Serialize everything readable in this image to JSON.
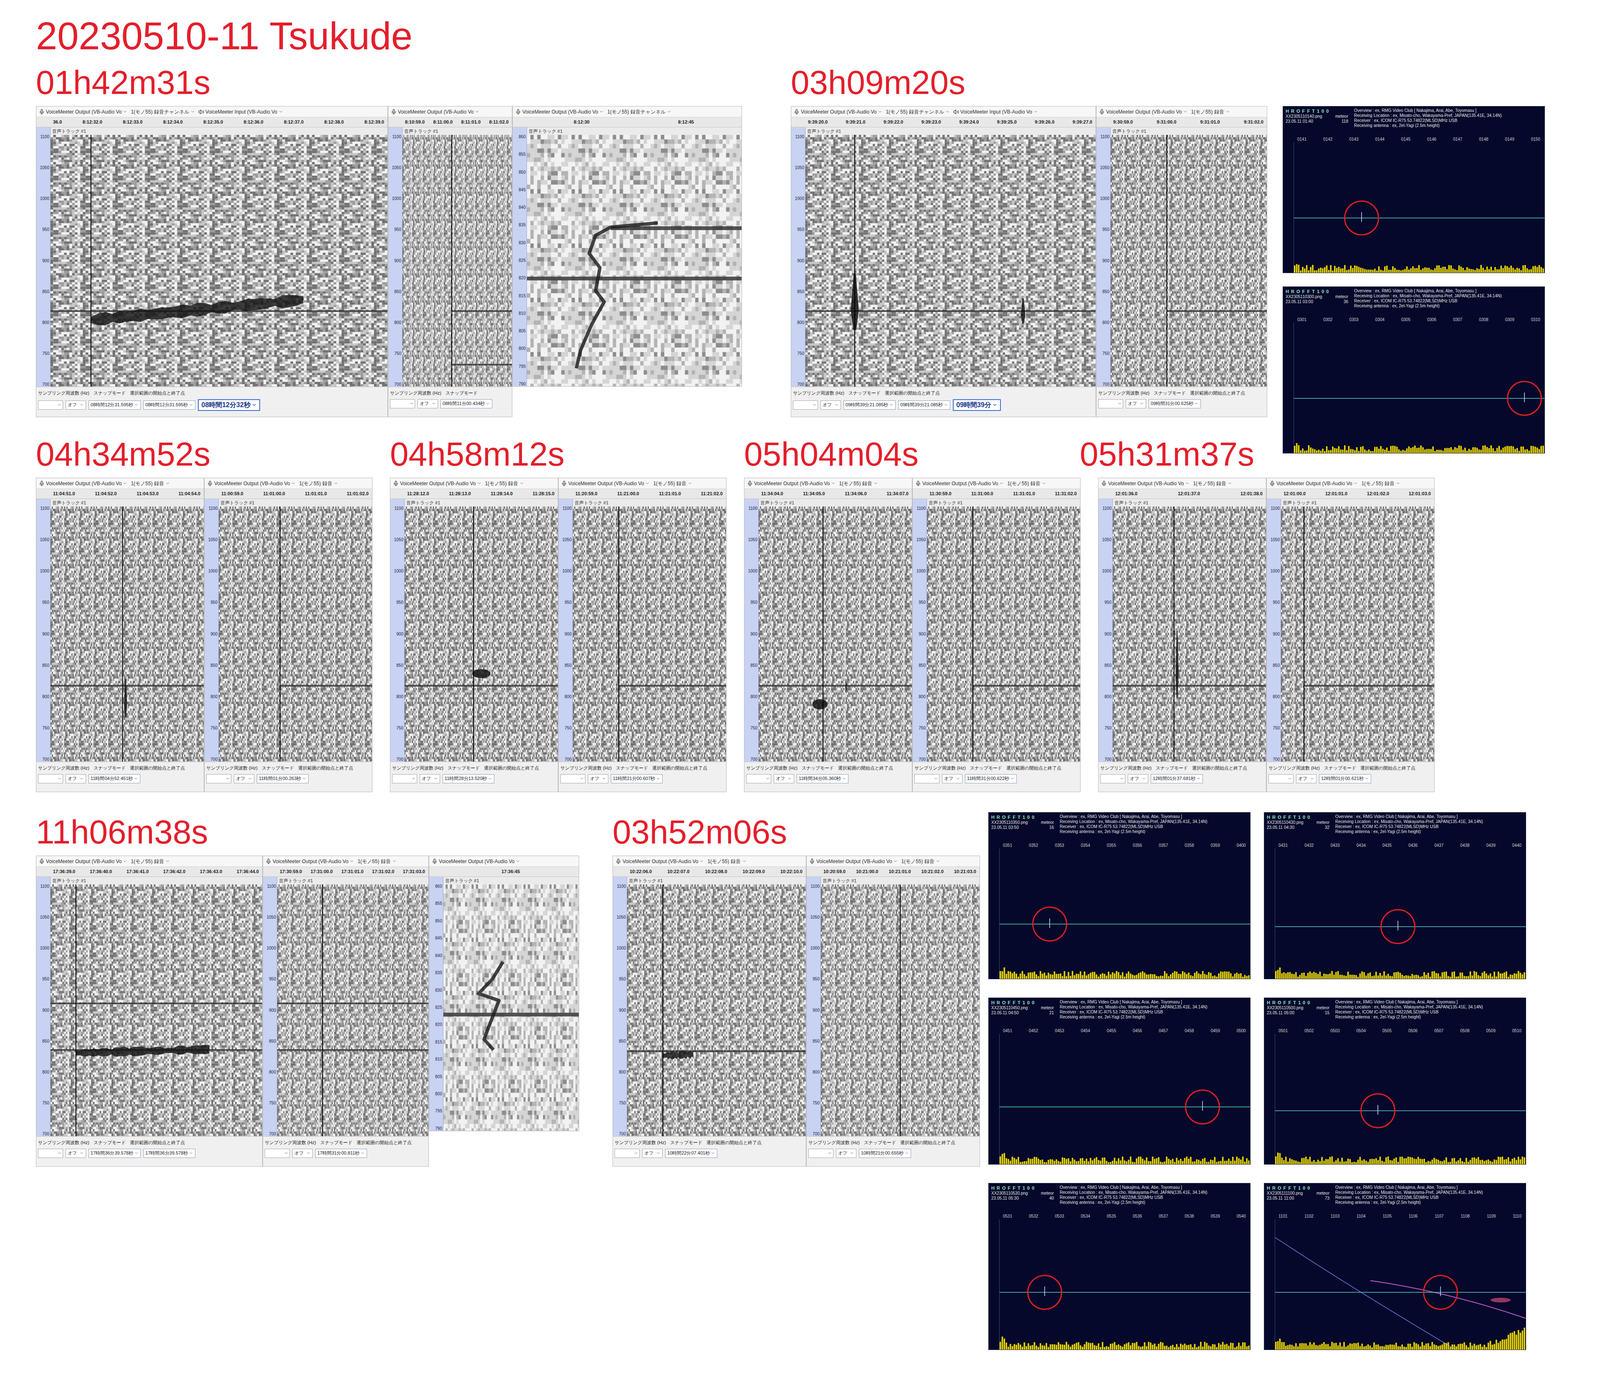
{
  "title": "20230510-11 Tsukude",
  "track_label": "音声トラック #1",
  "freq_ticks": [
    "1100",
    "1050",
    "1000",
    "950",
    "900",
    "850",
    "800",
    "750",
    "700"
  ],
  "zoom_ticks": [
    "860",
    "855",
    "850",
    "845",
    "840",
    "835",
    "830",
    "825",
    "820",
    "815",
    "810",
    "805",
    "800",
    "795",
    "790"
  ],
  "hroft_header": {
    "title": "H R O F F T 1 0 0",
    "info": [
      "Overview : ex, RMG Video Club [ Nakajima, Arai, Abe, Toyomasu ]",
      "Receiving Location : ex, Misato-cho, Wakayama-Pref, JAPAN(135.41E, 34.14N)",
      "Receiver : ex, ICOM IC-R75 53.74822(MLSD)MHz USB",
      "Receiving antenna : ex, 2el-Yagi (2.5m height)"
    ]
  },
  "groups": [
    {
      "time": "01h42m31s",
      "panels": [
        {
          "kind": "spectrogram",
          "toolbar": [
            "VoiceMeeter Output (VB-Audio Vo",
            "1(モノ55) 録音チャンネル",
            "VoiceMeeter Input (VB-Audio Vo"
          ],
          "ruler": [
            "36.0",
            "8:12:32.0",
            "8:12:33.0",
            "8:12:34.0",
            "8:12:35.0",
            "8:12:36.0",
            "8:12:37.0",
            "8:12:38.0",
            "8:12:39.0"
          ],
          "cursor": 0.12,
          "carriers": [
            {
              "hz": 820,
              "t0": 0
            }
          ],
          "echoes": [
            {
              "kind": "streak",
              "t0": 0.12,
              "t1": 0.75,
              "hz0": 806,
              "hz1": 838,
              "width": 22
            }
          ],
          "footer_labels": [
            "サンプリング周波数 (Hz)",
            "スナップモード",
            "選択範囲の開始点と終了点"
          ],
          "snap": "オフ",
          "selection": [
            "08時間12分31.595秒",
            "08時間12分31.595秒"
          ],
          "position": "08時間12分32秒"
        },
        {
          "kind": "spectrogram",
          "toolbar": [
            "VoiceMeeter Output (VB-Audio Vo"
          ],
          "ruler": [
            "8:10:59.0",
            "8:11:00.0",
            "8:11:01.0",
            "8:11:02.0"
          ],
          "cursor": 0.45,
          "carriers": [
            {
              "hz": 820,
              "t0": 0.45
            },
            {
              "hz": 735,
              "t0": 0.45
            }
          ],
          "echoes": [],
          "footer_labels": [
            "サンプリング周波数 (Hz)",
            "スナップモード"
          ],
          "snap": "オフ",
          "selection": [
            "08時間11分00.434秒"
          ]
        },
        {
          "kind": "zoom",
          "toolbar": [
            "VoiceMeeter Output (VB-Audio Vo",
            "1(モノ55) 録音チャンネル"
          ],
          "ruler": [
            "8:12:30",
            "8:12:45"
          ],
          "carriers": [
            {
              "hz": 820,
              "t0": 0
            },
            {
              "hz": 834,
              "t0": 0.39
            }
          ],
          "path": [
            [
              0.61,
              835.5
            ],
            [
              0.39,
              834.3
            ],
            [
              0.32,
              832
            ],
            [
              0.29,
              827
            ],
            [
              0.34,
              823
            ],
            [
              0.32,
              816.6
            ],
            [
              0.36,
              813.5
            ],
            [
              0.3,
              807
            ],
            [
              0.25,
              800
            ],
            [
              0.23,
              795
            ]
          ]
        }
      ]
    },
    {
      "time": "03h09m20s",
      "panels": [
        {
          "kind": "spectrogram",
          "toolbar": [
            "VoiceMeeter Output (VB-Audio Vo",
            "1(モノ55) 録音チャンネル",
            "VoiceMeeter Input (VB-Audio Vo"
          ],
          "ruler": [
            "9:39:20.0",
            "9:39:21.0",
            "9:39:22.0",
            "9:39:23.0",
            "9:39:24.0",
            "9:39:25.0",
            "9:39:26.0",
            "9:39:27.0"
          ],
          "cursor": 0.17,
          "carriers": [
            {
              "hz": 820,
              "t0": 0
            }
          ],
          "echoes": [
            {
              "kind": "spike",
              "t": 0.17,
              "hz0": 790,
              "hz1": 880,
              "width": 14
            },
            {
              "kind": "spike",
              "t": 0.75,
              "hz0": 800,
              "hz1": 840,
              "width": 8
            }
          ],
          "footer_labels": [
            "サンプリング周波数 (Hz)",
            "スナップモード",
            "選択範囲の開始点と終了点"
          ],
          "snap": "オフ",
          "selection": [
            "09時間39分21.085秒",
            "09時間39分21.085秒"
          ],
          "position": "09時間39分"
        },
        {
          "kind": "spectrogram",
          "toolbar": [
            "VoiceMeeter Output (VB-Audio Vo",
            "1(モノ55) 録音"
          ],
          "ruler": [
            "9:30:59.0",
            "9:31:00.0",
            "9:31:01.0",
            "9:31:02.0"
          ],
          "cursor": 0.36,
          "carriers": [
            {
              "hz": 820,
              "t0": 0.36
            }
          ],
          "echoes": [],
          "footer_labels": [
            "サンプリング周波数 (Hz)",
            "スナップモード",
            "選択範囲の開始点と終了点"
          ],
          "snap": "オフ",
          "selection": [
            "09時間31分00.625秒"
          ]
        }
      ],
      "hroft": [
        {
          "file": "XX2305110140.png",
          "label": "meteor",
          "count": "118",
          "date": "23.05.11 01:40",
          "ticks": [
            "0141",
            "0142",
            "0143",
            "0144",
            "0145",
            "0146",
            "0147",
            "0148",
            "0149",
            "0150"
          ],
          "line": 0.58,
          "mark": 0.27,
          "aircraft": false
        },
        {
          "file": "XX2305110300.png",
          "label": "meteor",
          "count": "36",
          "date": "23.05.11 03:00",
          "ticks": [
            "0301",
            "0302",
            "0303",
            "0304",
            "0305",
            "0306",
            "0307",
            "0308",
            "0309",
            "0310"
          ],
          "line": 0.58,
          "mark": 0.92,
          "aircraft": false
        }
      ]
    },
    {
      "time": "04h34m52s",
      "panels": [
        {
          "kind": "spectrogram",
          "toolbar": [
            "VoiceMeeter Output (VB-Audio Vo",
            "1(モノ55) 録音"
          ],
          "ruler": [
            "11:04:51.0",
            "11:04:52.0",
            "11:04:53.0",
            "11:04:54.0"
          ],
          "cursor": 0.47,
          "carriers": [
            {
              "hz": 819,
              "t0": 0
            }
          ],
          "echoes": [
            {
              "kind": "spike",
              "t": 0.49,
              "hz0": 770,
              "hz1": 830,
              "width": 10
            }
          ],
          "footer_labels": [
            "サンプリング周波数 (Hz)",
            "スナップモード",
            "選択範囲の開始点と終了点"
          ],
          "snap": "オフ",
          "selection": [
            "11時間04分52.451秒"
          ]
        },
        {
          "kind": "spectrogram",
          "toolbar": [
            "VoiceMeeter Output (VB-Audio Vo",
            "1(モノ55) 録音"
          ],
          "ruler": [
            "11:00:59.0",
            "11:01:00.0",
            "11:01:01.0",
            "11:01:02.0"
          ],
          "cursor": 0.4,
          "carriers": [
            {
              "hz": 819,
              "t0": 0.4
            }
          ],
          "echoes": [],
          "footer_labels": [
            "サンプリング周波数 (Hz)",
            "スナップモード",
            "選択範囲の開始点と終了点"
          ],
          "snap": "オフ",
          "selection": [
            "11時間01分00.263秒"
          ]
        }
      ]
    },
    {
      "time": "04h58m12s",
      "panels": [
        {
          "kind": "spectrogram",
          "toolbar": [
            "VoiceMeeter Output (VB-Audio Vo",
            "1(モノ55) 録音"
          ],
          "ruler": [
            "11:28:12.0",
            "11:28:13.0",
            "11:28:14.0",
            "11:28:15.0"
          ],
          "cursor": 0.45,
          "carriers": [
            {
              "hz": 819,
              "t0": 0
            }
          ],
          "echoes": [
            {
              "kind": "blob",
              "t": 0.5,
              "hz": 838,
              "dt": 0.12,
              "dhz": 14
            }
          ],
          "footer_labels": [
            "サンプリング周波数 (Hz)",
            "スナップモード",
            "選択範囲の開始点と終了点"
          ],
          "snap": "オフ",
          "selection": [
            "11時間28分13.520秒"
          ]
        },
        {
          "kind": "spectrogram",
          "toolbar": [
            "VoiceMeeter Output (VB-Audio Vo",
            "1(モノ55) 録音"
          ],
          "ruler": [
            "11:20:59.0",
            "11:21:00.0",
            "11:21:01.0",
            "11:21:02.0"
          ],
          "cursor": 0.3,
          "carriers": [
            {
              "hz": 819,
              "t0": 0.3
            }
          ],
          "echoes": [],
          "footer_labels": [
            "サンプリング周波数 (Hz)",
            "スナップモード",
            "選択範囲の開始点と終了点"
          ],
          "snap": "オフ",
          "selection": [
            "11時間21分00.607秒"
          ]
        }
      ]
    },
    {
      "time": "05h04m04s",
      "panels": [
        {
          "kind": "spectrogram",
          "toolbar": [
            "VoiceMeeter Output (VB-Audio Vo",
            "1(モノ55) 録音"
          ],
          "ruler": [
            "11:34:04.0",
            "11:34:05.0",
            "11:34:06.0",
            "11:34:07.0"
          ],
          "cursor": 0.42,
          "carriers": [
            {
              "hz": 819,
              "t0": 0
            }
          ],
          "echoes": [
            {
              "kind": "blob",
              "t": 0.4,
              "hz": 790,
              "dt": 0.1,
              "dhz": 16
            },
            {
              "kind": "spike",
              "t": 0.57,
              "hz0": 808,
              "hz1": 830,
              "width": 5
            }
          ],
          "footer_labels": [
            "サンプリング周波数 (Hz)",
            "スナップモード",
            "選択範囲の開始点と終了点"
          ],
          "snap": "オフ",
          "selection": [
            "11時間34分05.360秒"
          ]
        },
        {
          "kind": "spectrogram",
          "toolbar": [
            "VoiceMeeter Output (VB-Audio Vo",
            "1(モノ55) 録音"
          ],
          "ruler": [
            "11:30:59.0",
            "11:31:00.0",
            "11:31:01.0",
            "11:31:02.0"
          ],
          "cursor": 0.3,
          "carriers": [
            {
              "hz": 819,
              "t0": 0.3
            }
          ],
          "echoes": [],
          "footer_labels": [
            "サンプリング周波数 (Hz)",
            "スナップモード",
            "選択範囲の開始点と終了点"
          ],
          "snap": "オフ",
          "selection": [
            "11時間31分00.622秒"
          ]
        }
      ]
    },
    {
      "time": "05h31m37s",
      "panels": [
        {
          "kind": "spectrogram",
          "toolbar": [
            "VoiceMeeter Output (VB-Audio Vo",
            "1(モノ55) 録音"
          ],
          "ruler": [
            "12:01:36.0",
            "12:01:37.0",
            "12:01:38.0"
          ],
          "cursor": 0.4,
          "carriers": [
            {
              "hz": 819,
              "t0": 0
            }
          ],
          "echoes": [
            {
              "kind": "spike",
              "t": 0.42,
              "hz0": 800,
              "hz1": 905,
              "width": 10
            }
          ],
          "footer_labels": [
            "サンプリング周波数 (Hz)",
            "スナップモード",
            "選択範囲の開始点と終了点"
          ],
          "snap": "オフ",
          "selection": [
            "12時間01分37.681秒"
          ]
        },
        {
          "kind": "spectrogram",
          "toolbar": [
            "VoiceMeeter Output (VB-Audio Vo",
            "1(モノ55) 録音"
          ],
          "ruler": [
            "12:01:00.0",
            "12:01:01.0",
            "12:01:02.0",
            "12:01:03.0"
          ],
          "cursor": 0.15,
          "carriers": [
            {
              "hz": 819,
              "t0": 0.15
            }
          ],
          "echoes": [],
          "footer_labels": [
            "サンプリング周波数 (Hz)",
            "スナップモード",
            "選択範囲の開始点と終了点"
          ],
          "snap": "オフ",
          "selection": [
            "12時間01分00.621秒"
          ]
        }
      ]
    },
    {
      "time": "11h06m38s",
      "panels": [
        {
          "kind": "spectrogram",
          "toolbar": [
            "VoiceMeeter Output (VB-Audio Vo",
            "1(モノ55) 録音"
          ],
          "ruler": [
            "17:36:39.0",
            "17:36:40.0",
            "17:36:41.0",
            "17:36:42.0",
            "17:36:43.0",
            "17:36:44.0"
          ],
          "cursor": 0.12,
          "carriers": [
            {
              "hz": 911,
              "t0": 0
            },
            {
              "hz": 837,
              "t0": 0
            }
          ],
          "echoes": [
            {
              "kind": "streak",
              "t0": 0.12,
              "t1": 0.75,
              "hz0": 832,
              "hz1": 838,
              "width": 16
            }
          ],
          "footer_labels": [
            "サンプリング周波数 (Hz)",
            "スナップモード",
            "選択範囲の開始点と終了点"
          ],
          "snap": "オフ",
          "selection": [
            "17時間36分39.578秒",
            "17時間36分39.578秒"
          ]
        },
        {
          "kind": "spectrogram",
          "toolbar": [
            "VoiceMeeter Output (VB-Audio Vo",
            "1(モノ55) 録音"
          ],
          "ruler": [
            "17:30:59.0",
            "17:31:00.0",
            "17:31:01.0",
            "17:31:02.0",
            "17:31:03.0"
          ],
          "cursor": 0.3,
          "carriers": [
            {
              "hz": 911,
              "t0": 0
            },
            {
              "hz": 837,
              "t0": 0
            }
          ],
          "echoes": [],
          "footer_labels": [
            "サンプリング周波数 (Hz)",
            "スナップモード",
            "選択範囲の開始点と終了点"
          ],
          "snap": "オフ",
          "selection": [
            "17時間31分00.811秒"
          ]
        },
        {
          "kind": "zoom",
          "toolbar": [
            "VoiceMeeter Output (VB-Audio Vo"
          ],
          "ruler": [
            "17:36:45"
          ],
          "carriers": [
            {
              "hz": 823,
              "t0": 0
            }
          ],
          "path": [
            [
              0.44,
              838
            ],
            [
              0.36,
              833
            ],
            [
              0.26,
              829
            ],
            [
              0.41,
              827
            ],
            [
              0.36,
              822
            ],
            [
              0.3,
              816
            ],
            [
              0.37,
              813
            ]
          ]
        }
      ]
    },
    {
      "time": "03h52m06s",
      "panels": [
        {
          "kind": "spectrogram",
          "toolbar": [
            "VoiceMeeter Output (VB-Audio Vo",
            "1(モノ55) 録音"
          ],
          "ruler": [
            "10:22:06.0",
            "10:22:07.0",
            "10:22:08.0",
            "10:22:09.0",
            "10:22:10.0"
          ],
          "cursor": 0.2,
          "carriers": [
            {
              "hz": 835,
              "t0": 0
            }
          ],
          "echoes": [
            {
              "kind": "streak",
              "t0": 0.2,
              "t1": 0.37,
              "hz0": 828,
              "hz1": 830,
              "width": 14
            }
          ],
          "footer_labels": [
            "サンプリング周波数 (Hz)",
            "スナップモード",
            "選択範囲の開始点と終了点"
          ],
          "snap": "オフ",
          "selection": [
            "10時間22分07.401秒"
          ]
        },
        {
          "kind": "spectrogram",
          "toolbar": [
            "VoiceMeeter Output (VB-Audio Vo",
            "1(モノ55) 録音"
          ],
          "ruler": [
            "10:20:59.0",
            "10:21:00.0",
            "10:21:01.0",
            "10:21:02.0",
            "10:21:03.0"
          ],
          "cursor": 0.5,
          "carriers": [],
          "echoes": [],
          "footer_labels": [
            "サンプリング周波数 (Hz)",
            "スナップモード",
            "選択範囲の開始点と終了点"
          ],
          "snap": "オフ",
          "selection": [
            "10時間21分00.655秒"
          ]
        }
      ]
    }
  ],
  "hroft_grid": [
    {
      "file": "XX2305110350.png",
      "label": "meteor",
      "count": "16",
      "date": "23.05.11 03:50",
      "ticks": [
        "0351",
        "0352",
        "0353",
        "0354",
        "0355",
        "0356",
        "0357",
        "0358",
        "0359",
        "0400"
      ],
      "line": 0.58,
      "mark": 0.2,
      "aircraft": false
    },
    {
      "file": "XX2305110430.png",
      "label": "meteor",
      "count": "32",
      "date": "23.05.11 04:30",
      "ticks": [
        "0431",
        "0432",
        "0433",
        "0434",
        "0435",
        "0436",
        "0437",
        "0438",
        "0439",
        "0440"
      ],
      "line": 0.6,
      "mark": 0.49,
      "aircraft": false
    },
    {
      "file": "XX2305110450.png",
      "label": "meteor",
      "count": "21",
      "date": "23.05.11 04:50",
      "ticks": [
        "0451",
        "0452",
        "0453",
        "0454",
        "0455",
        "0456",
        "0457",
        "0458",
        "0459",
        "0500"
      ],
      "line": 0.56,
      "mark": 0.81,
      "aircraft": false
    },
    {
      "file": "XX2305110500.png",
      "label": "meteor",
      "count": "15",
      "date": "23.05.11 05:00",
      "ticks": [
        "0501",
        "0502",
        "0503",
        "0504",
        "0505",
        "0506",
        "0507",
        "0508",
        "0509",
        "0510"
      ],
      "line": 0.59,
      "mark": 0.41,
      "aircraft": false
    },
    {
      "file": "XX2305110530.png",
      "label": "meteor",
      "count": "40",
      "date": "23.05.11 05:30",
      "ticks": [
        "0531",
        "0532",
        "0533",
        "0534",
        "0535",
        "0536",
        "0537",
        "0538",
        "0539",
        "0540"
      ],
      "line": 0.56,
      "mark": 0.18,
      "aircraft": false
    },
    {
      "file": "XX2305111100.png",
      "label": "meteor",
      "count": "73",
      "date": "23.05.11 11:00",
      "ticks": [
        "1101",
        "1102",
        "1103",
        "1104",
        "1105",
        "1106",
        "1107",
        "1108",
        "1109",
        "1110"
      ],
      "line": 0.56,
      "mark": 0.66,
      "aircraft": true
    }
  ]
}
